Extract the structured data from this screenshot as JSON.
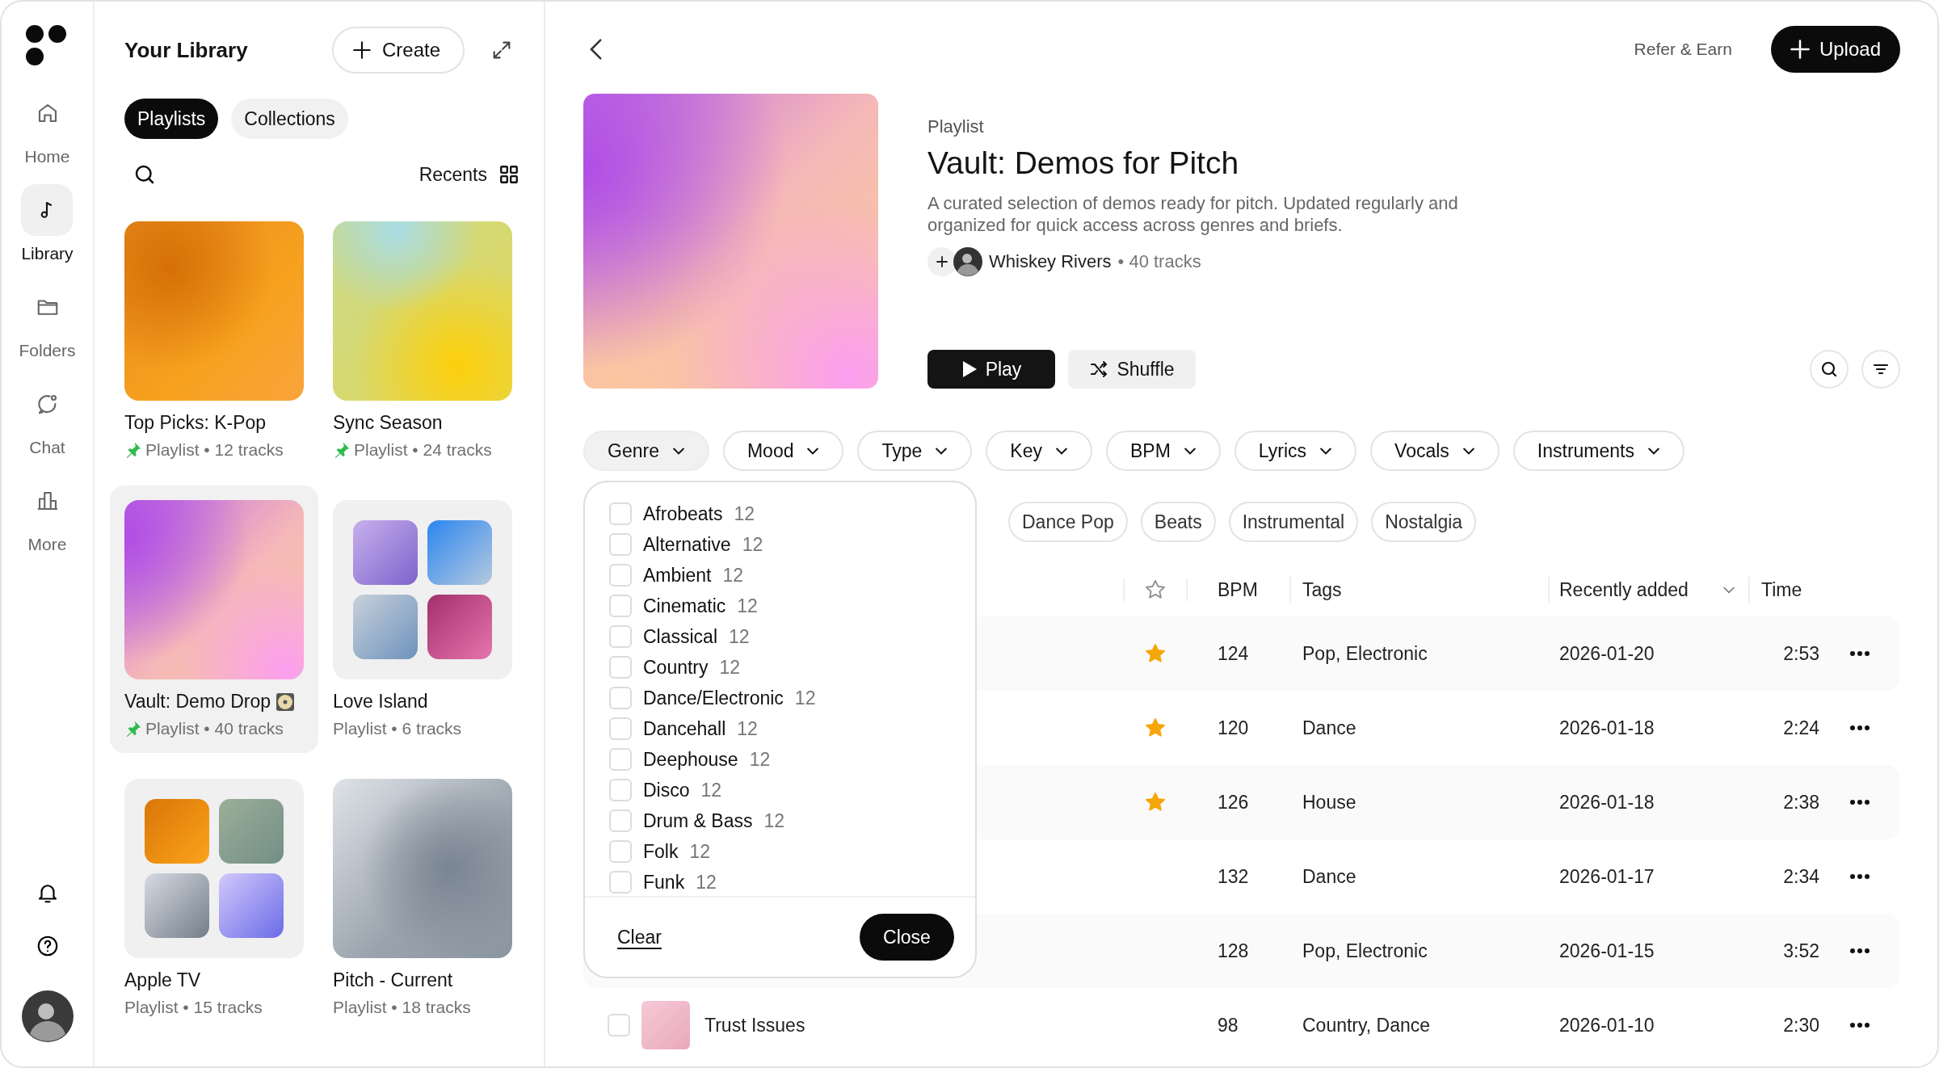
{
  "rail": {
    "items": [
      {
        "label": "Home",
        "kind": "home",
        "selected": false
      },
      {
        "label": "Library",
        "kind": "library",
        "selected": true
      },
      {
        "label": "Folders",
        "kind": "folders",
        "selected": false
      },
      {
        "label": "Chat",
        "kind": "chat",
        "selected": false
      },
      {
        "label": "More",
        "kind": "more",
        "selected": false
      }
    ]
  },
  "library": {
    "title": "Your Library",
    "create": "Create",
    "tabs": [
      {
        "label": "Playlists",
        "selected": true
      },
      {
        "label": "Collections",
        "selected": false
      }
    ],
    "sort": "Recents",
    "cards": [
      {
        "title": "Top Picks: K-Pop",
        "meta": "Playlist • 12 tracks",
        "pinned": true,
        "kind": "single",
        "selected": false,
        "disc": false
      },
      {
        "title": "Sync Season",
        "meta": "Playlist • 24 tracks",
        "pinned": true,
        "kind": "single",
        "selected": false,
        "disc": false
      },
      {
        "title": "Vault: Demo Drop",
        "meta": "Playlist • 40 tracks",
        "pinned": true,
        "kind": "single",
        "selected": true,
        "disc": true
      },
      {
        "title": "Love Island",
        "meta": "Playlist • 6 tracks",
        "pinned": false,
        "kind": "grid",
        "selected": false,
        "disc": false
      },
      {
        "title": "Apple TV",
        "meta": "Playlist • 15 tracks",
        "pinned": false,
        "kind": "grid",
        "selected": false,
        "disc": false
      },
      {
        "title": "Pitch - Current",
        "meta": "Playlist • 18 tracks",
        "pinned": false,
        "kind": "single",
        "selected": false,
        "disc": false
      }
    ]
  },
  "topbar": {
    "refer": "Refer & Earn",
    "upload": "Upload"
  },
  "playlist": {
    "label": "Playlist",
    "title": "Vault: Demos for Pitch",
    "description": "A curated selection of demos ready for pitch. Updated regularly and organized for quick access across genres and briefs.",
    "owner": "Whiskey Rivers",
    "count": "• 40 tracks",
    "play": "Play",
    "shuffle": "Shuffle"
  },
  "filters": [
    {
      "label": "Genre",
      "selected": true
    },
    {
      "label": "Mood",
      "selected": false
    },
    {
      "label": "Type",
      "selected": false
    },
    {
      "label": "Key",
      "selected": false
    },
    {
      "label": "BPM",
      "selected": false
    },
    {
      "label": "Lyrics",
      "selected": false
    },
    {
      "label": "Vocals",
      "selected": false
    },
    {
      "label": "Instruments",
      "selected": false
    }
  ],
  "tag_chips": [
    "Dance Pop",
    "Beats",
    "Instrumental",
    "Nostalgia"
  ],
  "genre_menu": {
    "options": [
      {
        "label": "Afrobeats",
        "count": "12",
        "checked": false
      },
      {
        "label": "Alternative",
        "count": "12",
        "checked": false
      },
      {
        "label": "Ambient",
        "count": "12",
        "checked": false
      },
      {
        "label": "Cinematic",
        "count": "12",
        "checked": false
      },
      {
        "label": "Classical",
        "count": "12",
        "checked": false
      },
      {
        "label": "Country",
        "count": "12",
        "checked": false
      },
      {
        "label": "Dance/Electronic",
        "count": "12",
        "checked": false
      },
      {
        "label": "Dancehall",
        "count": "12",
        "checked": false
      },
      {
        "label": "Deephouse",
        "count": "12",
        "checked": false
      },
      {
        "label": "Disco",
        "count": "12",
        "checked": false
      },
      {
        "label": "Drum & Bass",
        "count": "12",
        "checked": false
      },
      {
        "label": "Folk",
        "count": "12",
        "checked": false
      },
      {
        "label": "Funk",
        "count": "12",
        "checked": false
      }
    ],
    "clear": "Clear",
    "close": "Close"
  },
  "table": {
    "columns": [
      "BPM",
      "Tags",
      "Recently added",
      "Time"
    ],
    "rows": [
      {
        "starred": true,
        "bpm": "124",
        "tags": "Pop, Electronic",
        "added": "2026-01-20",
        "time": "2:53"
      },
      {
        "starred": true,
        "bpm": "120",
        "tags": "Dance",
        "added": "2026-01-18",
        "time": "2:24"
      },
      {
        "starred": true,
        "bpm": "126",
        "tags": "House",
        "added": "2026-01-18",
        "time": "2:38"
      },
      {
        "starred": false,
        "bpm": "132",
        "tags": "Dance",
        "added": "2026-01-17",
        "time": "2:34"
      },
      {
        "starred": false,
        "bpm": "128",
        "tags": "Pop, Electronic",
        "added": "2026-01-15",
        "time": "3:52"
      },
      {
        "starred": false,
        "title": "Trust Issues",
        "bpm": "98",
        "tags": "Country, Dance",
        "added": "2026-01-10",
        "time": "2:30"
      }
    ]
  }
}
